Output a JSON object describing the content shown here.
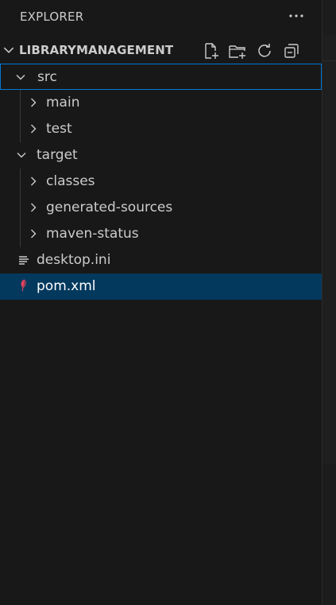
{
  "explorer": {
    "title": "EXPLORER",
    "more_icon": "ellipsis-icon"
  },
  "section": {
    "name": "LIBRARYMANAGEMENT",
    "actions": [
      "new-file-icon",
      "new-folder-icon",
      "refresh-icon",
      "collapse-all-icon"
    ]
  },
  "tree": [
    {
      "label": "src",
      "type": "folder",
      "expanded": true,
      "depth": 0
    },
    {
      "label": "main",
      "type": "folder",
      "expanded": false,
      "depth": 1
    },
    {
      "label": "test",
      "type": "folder",
      "expanded": false,
      "depth": 1
    },
    {
      "label": "target",
      "type": "folder",
      "expanded": true,
      "depth": 0
    },
    {
      "label": "classes",
      "type": "folder",
      "expanded": false,
      "depth": 1
    },
    {
      "label": "generated-sources",
      "type": "folder",
      "expanded": false,
      "depth": 1
    },
    {
      "label": "maven-status",
      "type": "folder",
      "expanded": false,
      "depth": 1
    },
    {
      "label": "desktop.ini",
      "type": "file",
      "icon": "settings-file-icon",
      "depth": 0
    },
    {
      "label": "pom.xml",
      "type": "file",
      "icon": "maven-feather-icon",
      "depth": 0,
      "selected": true
    }
  ],
  "colors": {
    "background": "#181818",
    "selection": "#04395e",
    "focus_border": "#0078d4",
    "maven_icon": "#e8435a"
  }
}
